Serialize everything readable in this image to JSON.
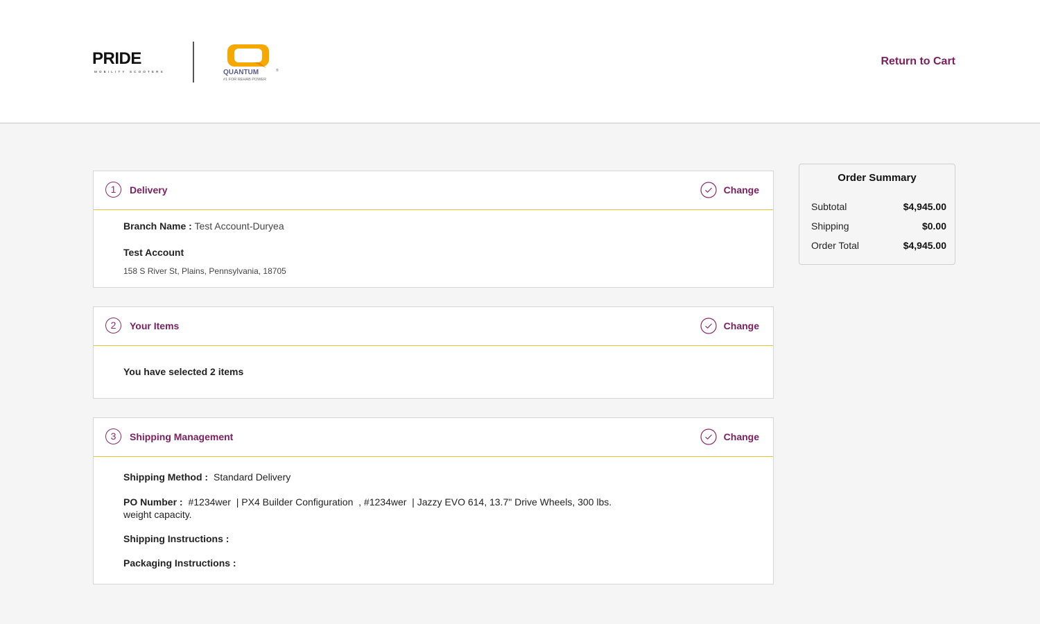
{
  "header": {
    "brand_pride": "PRIDE",
    "brand_pride_sub": "MOBILITY SCOOTERS",
    "brand_quantum": "QUANTUM",
    "brand_quantum_tagline": "#1 FOR REHAB POWER",
    "return_label": "Return to Cart"
  },
  "colors": {
    "accent": "#7b2060",
    "divider": "#e8c33a",
    "quantum_yellow": "#f5a800"
  },
  "sections": {
    "delivery": {
      "step": "1",
      "title": "Delivery",
      "change_label": "Change",
      "branch_label": "Branch Name :",
      "branch_value": "Test Account-Duryea",
      "account_name": "Test Account",
      "address": "158 S River St, Plains, Pennsylvania, 18705"
    },
    "items": {
      "step": "2",
      "title": "Your Items",
      "change_label": "Change",
      "summary_text": "You have selected 2 items"
    },
    "shipping": {
      "step": "3",
      "title": "Shipping Management",
      "change_label": "Change",
      "method_label": "Shipping Method :",
      "method_value": "Standard Delivery",
      "po_label": "PO Number :",
      "po_value_line1": "#1234wer  | PX4 Builder Configuration  , #1234wer  | Jazzy EVO 614, 13.7\" Drive Wheels, 300 lbs.",
      "po_value_line2": "weight capacity.",
      "instructions_label": "Shipping Instructions :",
      "packaging_label": "Packaging Instructions :"
    }
  },
  "order_summary": {
    "title": "Order Summary",
    "rows": [
      {
        "label": "Subtotal",
        "value": "$4,945.00"
      },
      {
        "label": "Shipping",
        "value": "$0.00"
      },
      {
        "label": "Order Total",
        "value": "$4,945.00"
      }
    ]
  }
}
